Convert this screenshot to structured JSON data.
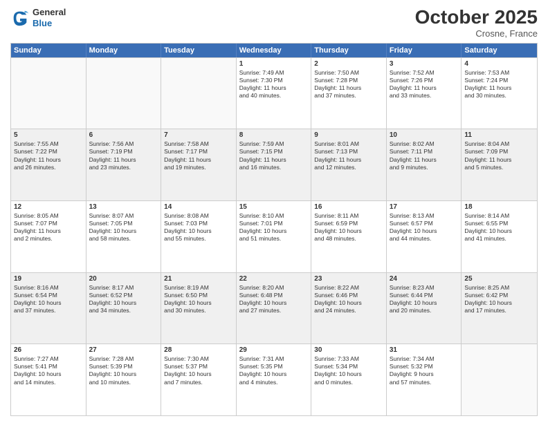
{
  "header": {
    "logo_general": "General",
    "logo_blue": "Blue",
    "month_title": "October 2025",
    "location": "Crosne, France"
  },
  "weekdays": [
    "Sunday",
    "Monday",
    "Tuesday",
    "Wednesday",
    "Thursday",
    "Friday",
    "Saturday"
  ],
  "rows": [
    [
      {
        "day": "",
        "text": "",
        "empty": true
      },
      {
        "day": "",
        "text": "",
        "empty": true
      },
      {
        "day": "",
        "text": "",
        "empty": true
      },
      {
        "day": "1",
        "text": "Sunrise: 7:49 AM\nSunset: 7:30 PM\nDaylight: 11 hours\nand 40 minutes."
      },
      {
        "day": "2",
        "text": "Sunrise: 7:50 AM\nSunset: 7:28 PM\nDaylight: 11 hours\nand 37 minutes."
      },
      {
        "day": "3",
        "text": "Sunrise: 7:52 AM\nSunset: 7:26 PM\nDaylight: 11 hours\nand 33 minutes."
      },
      {
        "day": "4",
        "text": "Sunrise: 7:53 AM\nSunset: 7:24 PM\nDaylight: 11 hours\nand 30 minutes."
      }
    ],
    [
      {
        "day": "5",
        "text": "Sunrise: 7:55 AM\nSunset: 7:22 PM\nDaylight: 11 hours\nand 26 minutes."
      },
      {
        "day": "6",
        "text": "Sunrise: 7:56 AM\nSunset: 7:19 PM\nDaylight: 11 hours\nand 23 minutes."
      },
      {
        "day": "7",
        "text": "Sunrise: 7:58 AM\nSunset: 7:17 PM\nDaylight: 11 hours\nand 19 minutes."
      },
      {
        "day": "8",
        "text": "Sunrise: 7:59 AM\nSunset: 7:15 PM\nDaylight: 11 hours\nand 16 minutes."
      },
      {
        "day": "9",
        "text": "Sunrise: 8:01 AM\nSunset: 7:13 PM\nDaylight: 11 hours\nand 12 minutes."
      },
      {
        "day": "10",
        "text": "Sunrise: 8:02 AM\nSunset: 7:11 PM\nDaylight: 11 hours\nand 9 minutes."
      },
      {
        "day": "11",
        "text": "Sunrise: 8:04 AM\nSunset: 7:09 PM\nDaylight: 11 hours\nand 5 minutes."
      }
    ],
    [
      {
        "day": "12",
        "text": "Sunrise: 8:05 AM\nSunset: 7:07 PM\nDaylight: 11 hours\nand 2 minutes."
      },
      {
        "day": "13",
        "text": "Sunrise: 8:07 AM\nSunset: 7:05 PM\nDaylight: 10 hours\nand 58 minutes."
      },
      {
        "day": "14",
        "text": "Sunrise: 8:08 AM\nSunset: 7:03 PM\nDaylight: 10 hours\nand 55 minutes."
      },
      {
        "day": "15",
        "text": "Sunrise: 8:10 AM\nSunset: 7:01 PM\nDaylight: 10 hours\nand 51 minutes."
      },
      {
        "day": "16",
        "text": "Sunrise: 8:11 AM\nSunset: 6:59 PM\nDaylight: 10 hours\nand 48 minutes."
      },
      {
        "day": "17",
        "text": "Sunrise: 8:13 AM\nSunset: 6:57 PM\nDaylight: 10 hours\nand 44 minutes."
      },
      {
        "day": "18",
        "text": "Sunrise: 8:14 AM\nSunset: 6:55 PM\nDaylight: 10 hours\nand 41 minutes."
      }
    ],
    [
      {
        "day": "19",
        "text": "Sunrise: 8:16 AM\nSunset: 6:54 PM\nDaylight: 10 hours\nand 37 minutes."
      },
      {
        "day": "20",
        "text": "Sunrise: 8:17 AM\nSunset: 6:52 PM\nDaylight: 10 hours\nand 34 minutes."
      },
      {
        "day": "21",
        "text": "Sunrise: 8:19 AM\nSunset: 6:50 PM\nDaylight: 10 hours\nand 30 minutes."
      },
      {
        "day": "22",
        "text": "Sunrise: 8:20 AM\nSunset: 6:48 PM\nDaylight: 10 hours\nand 27 minutes."
      },
      {
        "day": "23",
        "text": "Sunrise: 8:22 AM\nSunset: 6:46 PM\nDaylight: 10 hours\nand 24 minutes."
      },
      {
        "day": "24",
        "text": "Sunrise: 8:23 AM\nSunset: 6:44 PM\nDaylight: 10 hours\nand 20 minutes."
      },
      {
        "day": "25",
        "text": "Sunrise: 8:25 AM\nSunset: 6:42 PM\nDaylight: 10 hours\nand 17 minutes."
      }
    ],
    [
      {
        "day": "26",
        "text": "Sunrise: 7:27 AM\nSunset: 5:41 PM\nDaylight: 10 hours\nand 14 minutes."
      },
      {
        "day": "27",
        "text": "Sunrise: 7:28 AM\nSunset: 5:39 PM\nDaylight: 10 hours\nand 10 minutes."
      },
      {
        "day": "28",
        "text": "Sunrise: 7:30 AM\nSunset: 5:37 PM\nDaylight: 10 hours\nand 7 minutes."
      },
      {
        "day": "29",
        "text": "Sunrise: 7:31 AM\nSunset: 5:35 PM\nDaylight: 10 hours\nand 4 minutes."
      },
      {
        "day": "30",
        "text": "Sunrise: 7:33 AM\nSunset: 5:34 PM\nDaylight: 10 hours\nand 0 minutes."
      },
      {
        "day": "31",
        "text": "Sunrise: 7:34 AM\nSunset: 5:32 PM\nDaylight: 9 hours\nand 57 minutes."
      },
      {
        "day": "",
        "text": "",
        "empty": true
      }
    ]
  ]
}
